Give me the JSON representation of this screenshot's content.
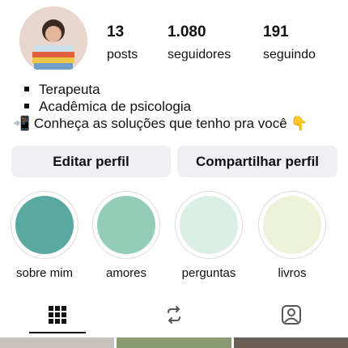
{
  "profile": {
    "stats": [
      {
        "value": "13",
        "label": "posts"
      },
      {
        "value": "1.080",
        "label": "seguidores"
      },
      {
        "value": "191",
        "label": "seguindo"
      }
    ],
    "bio": [
      "Terapeuta",
      "Acadêmica de psicologia",
      "📲 Conheça as soluções que tenho pra você 👇"
    ]
  },
  "buttons": {
    "edit": "Editar perfil",
    "share": "Compartilhar perfil"
  },
  "highlights": [
    {
      "label": "sobre mim",
      "color": "#5aa9a0"
    },
    {
      "label": "amores",
      "color": "#94cdb7"
    },
    {
      "label": "perguntas",
      "color": "#dcefe4"
    },
    {
      "label": "livros",
      "color": "#edf3d8"
    }
  ],
  "tabs": {
    "icons": [
      "grid-icon",
      "reels-icon",
      "tagged-icon"
    ],
    "active": "grid-icon"
  }
}
